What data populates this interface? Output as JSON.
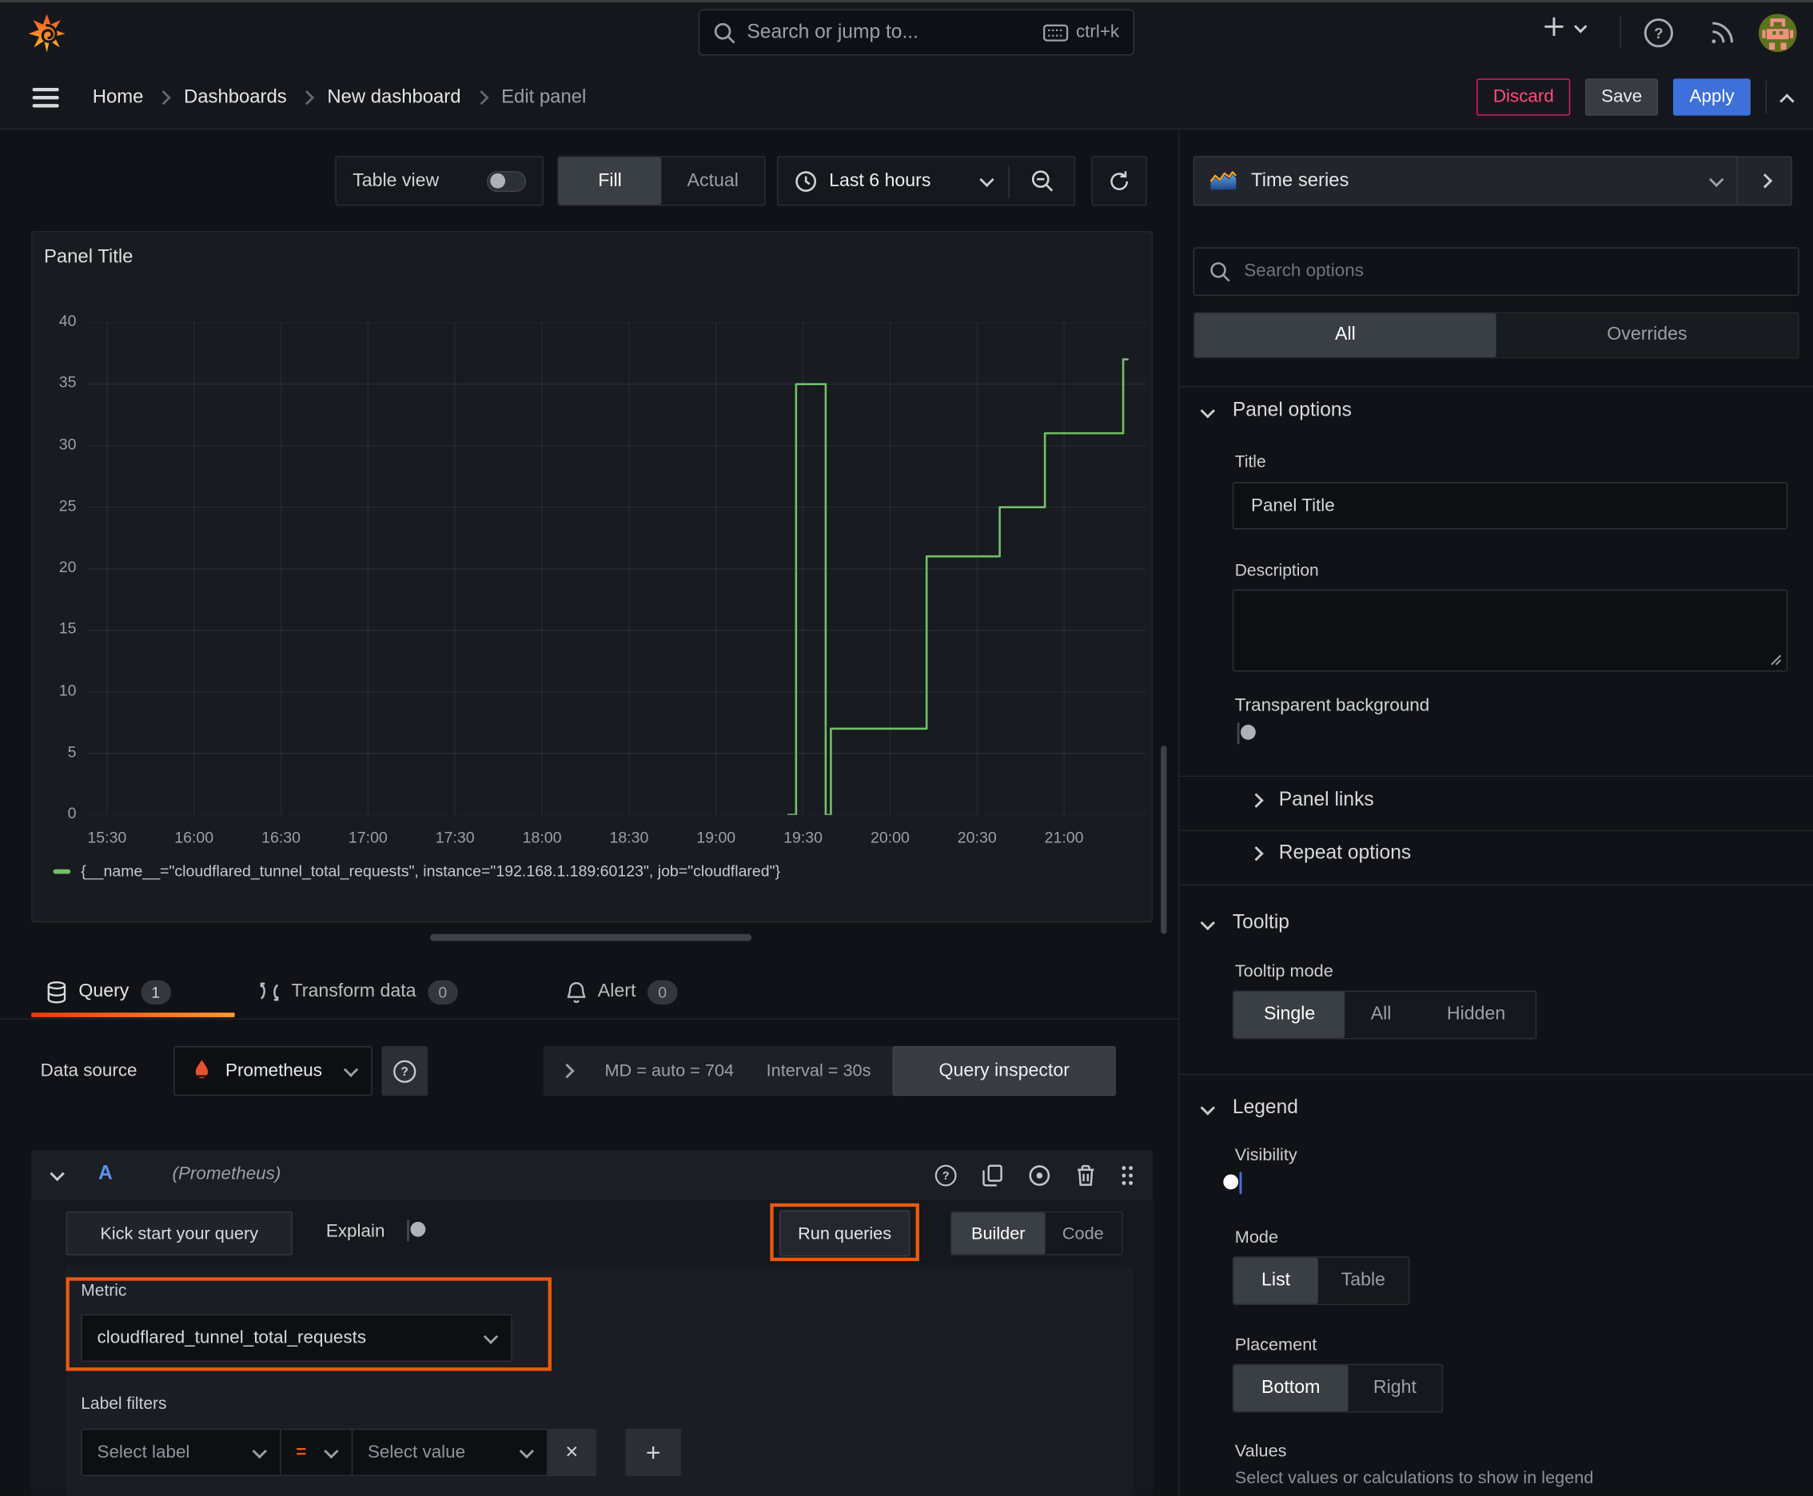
{
  "topbar": {
    "search_placeholder": "Search or jump to...",
    "search_shortcut": "ctrl+k"
  },
  "breadcrumb": {
    "items": [
      {
        "label": "Home"
      },
      {
        "label": "Dashboards"
      },
      {
        "label": "New dashboard"
      },
      {
        "label": "Edit panel"
      }
    ],
    "discard_label": "Discard",
    "save_label": "Save",
    "apply_label": "Apply"
  },
  "toolbar": {
    "table_view_label": "Table view",
    "fill_label": "Fill",
    "actual_label": "Actual",
    "time_range_label": "Last 6 hours"
  },
  "visualization": {
    "name": "Time series"
  },
  "panel": {
    "title": "Panel Title"
  },
  "chart_data": {
    "type": "line",
    "step": true,
    "grid": true,
    "title": "Panel Title",
    "x_range": [
      15.39,
      21.47
    ],
    "y_range": [
      0,
      40
    ],
    "y_ticks": [
      0,
      5,
      10,
      15,
      20,
      25,
      30,
      35,
      40
    ],
    "x_ticks": [
      [
        15.5,
        "15:30"
      ],
      [
        16,
        "16:00"
      ],
      [
        16.5,
        "16:30"
      ],
      [
        17,
        "17:00"
      ],
      [
        17.5,
        "17:30"
      ],
      [
        18,
        "18:00"
      ],
      [
        18.5,
        "18:30"
      ],
      [
        19,
        "19:00"
      ],
      [
        19.5,
        "19:30"
      ],
      [
        20,
        "20:00"
      ],
      [
        20.5,
        "20:30"
      ],
      [
        21,
        "21:00"
      ]
    ],
    "legend_position": "bottom",
    "series": [
      {
        "name": "{__name__=\"cloudflared_tunnel_total_requests\", instance=\"192.168.1.189:60123\", job=\"cloudflared\"}",
        "color": "#73bf69",
        "points": [
          [
            19.41,
            0
          ],
          [
            19.46,
            0
          ],
          [
            19.46,
            35
          ],
          [
            19.63,
            35
          ],
          [
            19.63,
            0
          ],
          [
            19.66,
            0
          ],
          [
            19.66,
            7
          ],
          [
            20.21,
            7
          ],
          [
            20.21,
            21
          ],
          [
            20.63,
            21
          ],
          [
            20.63,
            25
          ],
          [
            20.89,
            25
          ],
          [
            20.89,
            31
          ],
          [
            21.34,
            31
          ],
          [
            21.34,
            37
          ],
          [
            21.37,
            37
          ]
        ]
      }
    ]
  },
  "tabs": {
    "query_label": "Query",
    "query_count": "1",
    "transform_label": "Transform data",
    "transform_count": "0",
    "alert_label": "Alert",
    "alert_count": "0"
  },
  "datasource": {
    "label": "Data source",
    "name": "Prometheus",
    "meta_md": "MD = auto = 704",
    "meta_interval": "Interval = 30s",
    "inspector_label": "Query inspector"
  },
  "query_row": {
    "ref_id": "A",
    "ds_hint": "(Prometheus)"
  },
  "editor": {
    "kick_start_label": "Kick start your query",
    "explain_label": "Explain",
    "run_queries_label": "Run queries",
    "builder_label": "Builder",
    "code_label": "Code",
    "metric_label": "Metric",
    "metric_value": "cloudflared_tunnel_total_requests",
    "label_filters_label": "Label filters",
    "select_label_placeholder": "Select label",
    "operator_value": "=",
    "select_value_placeholder": "Select value",
    "remove_filter_icon": "×",
    "add_filter_icon": "+"
  },
  "options": {
    "search_placeholder": "Search options",
    "tab_all": "All",
    "tab_overrides": "Overrides",
    "panel_options_header": "Panel options",
    "title_label": "Title",
    "title_value": "Panel Title",
    "description_label": "Description",
    "transparent_label": "Transparent background",
    "panel_links_label": "Panel links",
    "repeat_options_label": "Repeat options",
    "tooltip_header": "Tooltip",
    "tooltip_mode_label": "Tooltip mode",
    "tooltip_single": "Single",
    "tooltip_all": "All",
    "tooltip_hidden": "Hidden",
    "legend_header": "Legend",
    "visibility_label": "Visibility",
    "mode_label": "Mode",
    "mode_list": "List",
    "mode_table": "Table",
    "placement_label": "Placement",
    "placement_bottom": "Bottom",
    "placement_right": "Right",
    "values_label": "Values",
    "values_help": "Select values or calculations to show in legend"
  },
  "colors": {
    "highlight_orange": "#e9590f",
    "series_green": "#73bf69",
    "primary_blue": "#3d71d9",
    "danger_pink": "#e0226e"
  }
}
